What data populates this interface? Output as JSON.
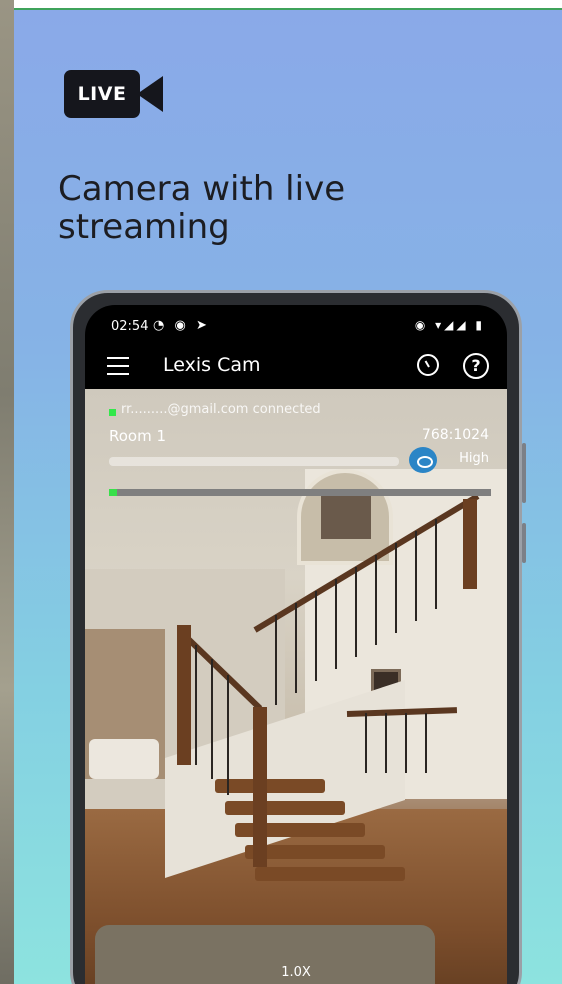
{
  "badge": {
    "label": "LIVE",
    "icon": "video-camera-icon"
  },
  "headline": "Camera with live streaming",
  "phone": {
    "status_bar": {
      "time": "02:54",
      "left_icons": "◔ ◉ ➤",
      "right_icons": "◉ ▾◢◢ ▮"
    },
    "app_bar": {
      "title": "Lexis Cam",
      "menu_icon": "menu-icon",
      "timer_icon": "timer-icon",
      "help_icon": "help-icon",
      "help_glyph": "?"
    },
    "stream": {
      "connected_text": "rr.........@gmail.com connected",
      "room": "Room 1",
      "resolution": "768:1024",
      "quality": "High",
      "zoom": "1.0X",
      "progress": 0.02,
      "colors": {
        "accent_green": "#38e04a",
        "eye_blue": "#2b85c6"
      }
    }
  }
}
